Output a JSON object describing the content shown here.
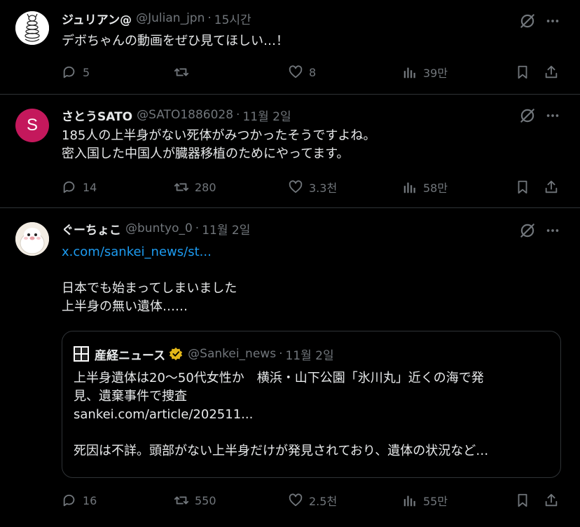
{
  "colors": {
    "background": "#000000",
    "text": "#e7e9ea",
    "muted": "#71767b",
    "link": "#1d9bf0",
    "divider": "#2f3336",
    "verified": "#e2b719",
    "sato_avatar": "#c4185c"
  },
  "tweets": [
    {
      "name": "ジュリアン@",
      "handle": "@Julian_jpn",
      "time": "15시간",
      "lines": [
        "デボちゃんの動画をぜひ見てほしい…！"
      ],
      "replies": "5",
      "retweets": "",
      "likes": "8",
      "views": "39만"
    },
    {
      "name": "さとうSATO",
      "handle": "@SATO1886028",
      "time": "11월 2일",
      "avatar_letter": "S",
      "lines": [
        "185人の上半身がない死体がみつかったそうですよね。",
        "密入国した中国人が臓器移植のためにやってます。"
      ],
      "replies": "14",
      "retweets": "280",
      "likes": "3.3천",
      "views": "58만"
    },
    {
      "name": "ぐーちょこ",
      "handle": "@buntyo_0",
      "time": "11월 2일",
      "link": "x.com/sankei_news/st...",
      "lines": [
        "日本でも始まってしまいました",
        "上半身の無い遺体……"
      ],
      "replies": "16",
      "retweets": "550",
      "likes": "2.5천",
      "views": "55만",
      "quote": {
        "name": "産経ニュース",
        "handle": "@Sankei_news",
        "time": "11월 2일",
        "lines": [
          "上半身遺体は20〜50代女性か　横浜・山下公園「氷川丸」近くの海で発",
          "見、遺棄事件で捜査",
          "sankei.com/article/202511...",
          "",
          "死因は不詳。頭部がない上半身だけが発見されており、遺体の状況など…"
        ]
      }
    }
  ],
  "icons": [
    "reply-icon",
    "retweet-icon",
    "like-icon",
    "views-icon",
    "bookmark-icon",
    "share-icon",
    "grok-icon",
    "more-icon",
    "verified-badge-icon"
  ]
}
